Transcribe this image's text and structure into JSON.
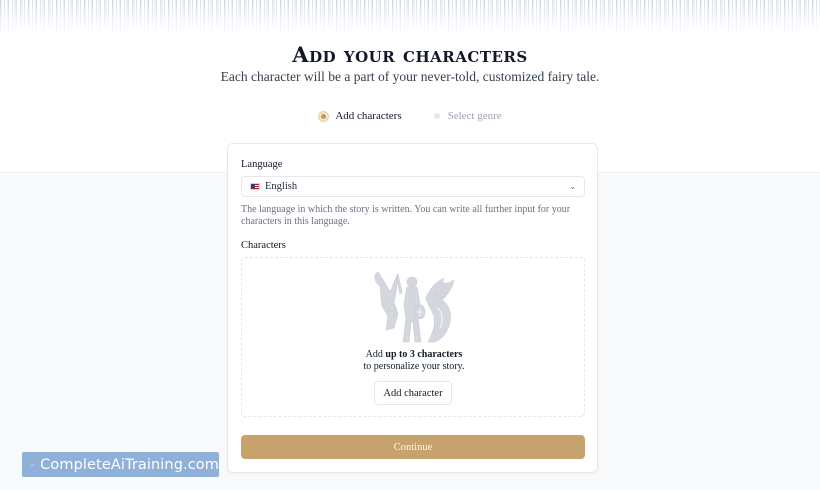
{
  "hero": {
    "title": "Add your characters",
    "subtitle": "Each character will be a part of your never-told, customized fairy tale."
  },
  "stepper": {
    "steps": [
      {
        "label": "Add characters",
        "active": true
      },
      {
        "label": "Select genre",
        "active": false
      }
    ]
  },
  "form": {
    "language_label": "Language",
    "language_value": "English",
    "language_icon": "us-flag-icon",
    "language_help": "The language in which the story is written. You can write all further input for your characters in this language.",
    "characters_label": "Characters",
    "dropzone": {
      "line1_prefix": "Add ",
      "line1_bold": "up to 3 characters",
      "line2": "to personalize your story.",
      "add_button": "Add character"
    },
    "continue_button": "Continue"
  },
  "colors": {
    "accent": "#c7a26c",
    "background": "#f8f9fb"
  },
  "watermark": {
    "text": "CompleteAiTraining.com",
    "logo_icon": "sparkle-logo-icon"
  }
}
